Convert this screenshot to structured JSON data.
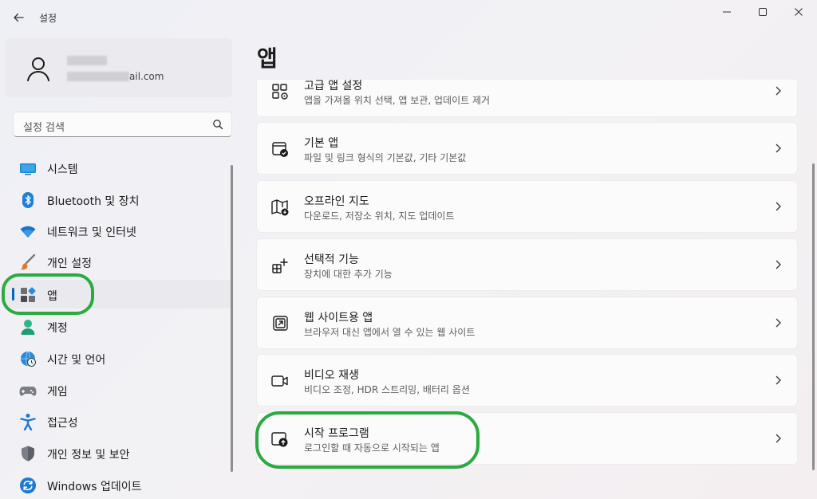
{
  "window": {
    "title": "설정",
    "back_icon": "arrow-left-icon",
    "controls": [
      "minimize-icon",
      "maximize-icon",
      "close-icon"
    ]
  },
  "account": {
    "email_suffix": "ail.com",
    "icon": "person-icon"
  },
  "search": {
    "placeholder": "설정 검색",
    "icon": "search-icon"
  },
  "sidebar": {
    "items": [
      {
        "label": "시스템",
        "icon": "monitor-icon"
      },
      {
        "label": "Bluetooth 및 장치",
        "icon": "bluetooth-icon"
      },
      {
        "label": "네트워크 및 인터넷",
        "icon": "wifi-icon"
      },
      {
        "label": "개인 설정",
        "icon": "paintbrush-icon"
      },
      {
        "label": "앱",
        "icon": "apps-icon",
        "active": true
      },
      {
        "label": "계정",
        "icon": "account-icon"
      },
      {
        "label": "시간 및 언어",
        "icon": "globe-clock-icon"
      },
      {
        "label": "게임",
        "icon": "gamepad-icon"
      },
      {
        "label": "접근성",
        "icon": "accessibility-icon"
      },
      {
        "label": "개인 정보 및 보안",
        "icon": "shield-icon"
      },
      {
        "label": "Windows 업데이트",
        "icon": "update-icon"
      }
    ]
  },
  "main": {
    "title": "앱",
    "cards": [
      {
        "title": "고급 앱 설정",
        "subtitle": "앱을 가져올 위치 선택, 앱 보관, 업데이트 제거",
        "icon": "advanced-app-settings-icon"
      },
      {
        "title": "기본 앱",
        "subtitle": "파일 및 링크 형식의 기본값, 기타 기본값",
        "icon": "default-apps-icon"
      },
      {
        "title": "오프라인 지도",
        "subtitle": "다운로드, 저장소 위치, 지도 업데이트",
        "icon": "offline-map-icon"
      },
      {
        "title": "선택적 기능",
        "subtitle": "장치에 대한 추가 기능",
        "icon": "optional-features-icon"
      },
      {
        "title": "웹 사이트용 앱",
        "subtitle": "브라우저 대신 앱에서 열 수 있는 웹 사이트",
        "icon": "apps-for-websites-icon"
      },
      {
        "title": "비디오 재생",
        "subtitle": "비디오 조정, HDR 스트리밍, 배터리 옵션",
        "icon": "video-camera-icon"
      },
      {
        "title": "시작 프로그램",
        "subtitle": "로그인할 때 자동으로 시작되는 앱",
        "icon": "startup-icon"
      }
    ]
  },
  "colors": {
    "accent": "#0067c0",
    "highlight": "#2bab3f"
  }
}
